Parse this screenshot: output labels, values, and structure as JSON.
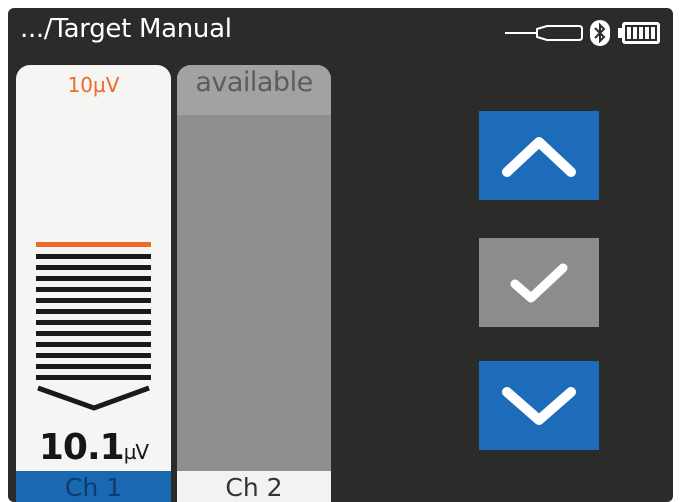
{
  "header": {
    "title": ".../Target Manual",
    "icons": [
      "probe-icon",
      "bluetooth-icon",
      "battery-icon"
    ]
  },
  "channel1": {
    "target": "10µV",
    "reading_value": "10.1",
    "reading_unit": "µV",
    "tab_label": "Ch 1",
    "selected": true
  },
  "channel2": {
    "status": "available",
    "tab_label": "Ch 2"
  },
  "controls": {
    "up_icon": "chevron-up-icon",
    "confirm_icon": "checkmark-icon",
    "down_icon": "chevron-down-icon"
  },
  "colors": {
    "background": "#2b2b2a",
    "accent_blue": "#1c6cba",
    "target_orange": "#ee6a2a",
    "disabled_gray": "#8f8f8e"
  }
}
